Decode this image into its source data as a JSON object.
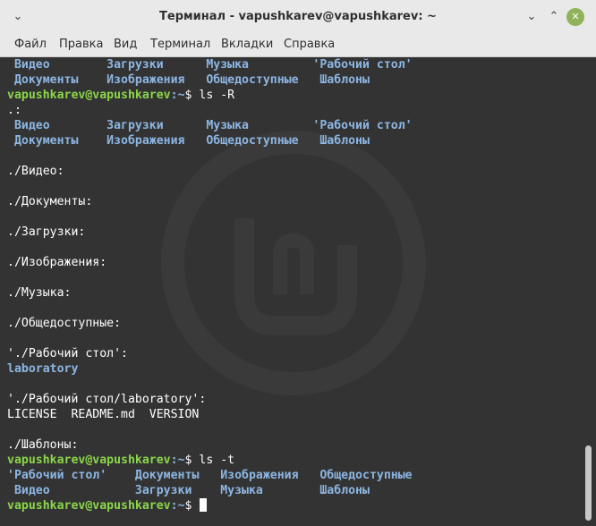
{
  "window": {
    "title": "Терминал - vapushkarev@vapushkarev: ~"
  },
  "menu": [
    "Файл",
    "Правка",
    "Вид",
    "Терминал",
    "Вкладки",
    "Справка"
  ],
  "terminal": {
    "prompt_user": "vapushkarev@vapushkarev",
    "prompt_path": ":~",
    "prompt_symbol": "$ ",
    "lines": [
      {
        "type": "cols",
        "cols": [
          " Видео",
          " Загрузки",
          " Музыка",
          "'Рабочий стол'"
        ]
      },
      {
        "type": "cols",
        "cols": [
          " Документы",
          " Изображения",
          " Общедоступные",
          " Шаблоны"
        ]
      },
      {
        "type": "prompt",
        "cmd": "ls -R"
      },
      {
        "type": "text",
        "text": ".:"
      },
      {
        "type": "cols",
        "cols": [
          " Видео",
          " Загрузки",
          " Музыка",
          "'Рабочий стол'"
        ]
      },
      {
        "type": "cols",
        "cols": [
          " Документы",
          " Изображения",
          " Общедоступные",
          " Шаблоны"
        ]
      },
      {
        "type": "text",
        "text": ""
      },
      {
        "type": "text",
        "text": "./Видео:"
      },
      {
        "type": "text",
        "text": ""
      },
      {
        "type": "text",
        "text": "./Документы:"
      },
      {
        "type": "text",
        "text": ""
      },
      {
        "type": "text",
        "text": "./Загрузки:"
      },
      {
        "type": "text",
        "text": ""
      },
      {
        "type": "text",
        "text": "./Изображения:"
      },
      {
        "type": "text",
        "text": ""
      },
      {
        "type": "text",
        "text": "./Музыка:"
      },
      {
        "type": "text",
        "text": ""
      },
      {
        "type": "text",
        "text": "./Общедоступные:"
      },
      {
        "type": "text",
        "text": ""
      },
      {
        "type": "text",
        "text": "'./Рабочий стол':"
      },
      {
        "type": "dir",
        "text": "laboratory"
      },
      {
        "type": "text",
        "text": ""
      },
      {
        "type": "text",
        "text": "'./Рабочий стол/laboratory':"
      },
      {
        "type": "text",
        "text": "LICENSE  README.md  VERSION"
      },
      {
        "type": "text",
        "text": ""
      },
      {
        "type": "text",
        "text": "./Шаблоны:"
      },
      {
        "type": "prompt",
        "cmd": "ls -t"
      },
      {
        "type": "cols2",
        "cols": [
          "'Рабочий стол'",
          " Документы",
          " Изображения",
          " Общедоступные"
        ]
      },
      {
        "type": "cols2",
        "cols": [
          " Видео",
          " Загрузки",
          " Музыка",
          " Шаблоны"
        ]
      },
      {
        "type": "prompt",
        "cmd": "",
        "cursor": true
      }
    ]
  }
}
